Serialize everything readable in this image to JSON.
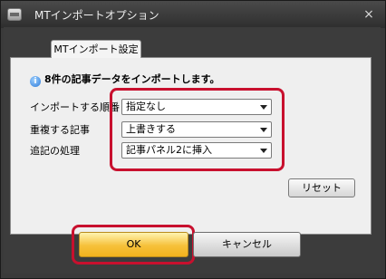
{
  "window": {
    "title": "MTインポートオプション",
    "close_glyph": "×",
    "icon": "app-window-icon"
  },
  "tabs": [
    {
      "label": "MTインポート設定",
      "selected": true
    }
  ],
  "info": {
    "icon": "info-icon",
    "icon_glyph": "i",
    "message": "8件の記事データをインポートします。"
  },
  "fields": {
    "import_order": {
      "label": "インポートする順番",
      "value": "指定なし"
    },
    "duplicate_articles": {
      "label": "重複する記事",
      "value": "上書きする"
    },
    "append_handling": {
      "label": "追記の処理",
      "value": "記事パネル2に挿入"
    }
  },
  "buttons": {
    "reset": "リセット",
    "ok": "OK",
    "cancel": "キャンセル"
  },
  "colors": {
    "highlight": "#c8102e",
    "ok_button": "#f6c13a",
    "window_bg": "#3c3c3c"
  }
}
